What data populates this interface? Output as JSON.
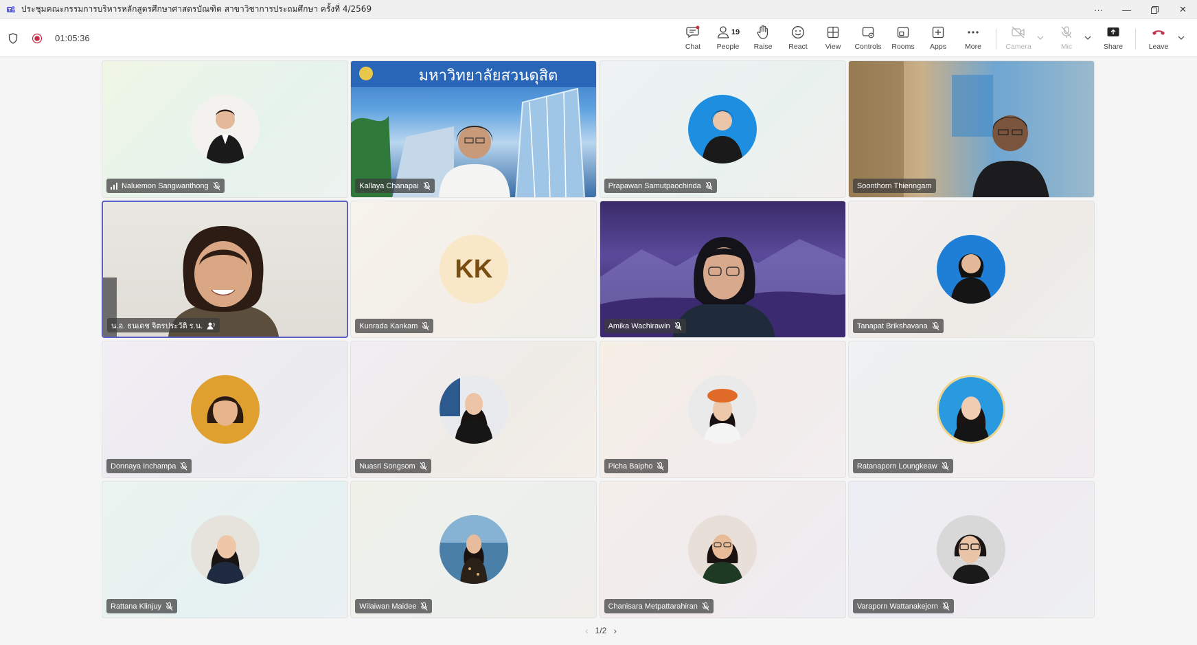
{
  "window": {
    "title": "ประชุมคณะกรรมการบริหารหลักสูตรศึกษาศาสตรบัณฑิต สาขาวิชาการประถมศึกษา ครั้งที่ 4/2569"
  },
  "meeting": {
    "elapsed": "01:05:36"
  },
  "toolbar": {
    "chat": "Chat",
    "people": "People",
    "people_count": "19",
    "raise": "Raise",
    "react": "React",
    "view": "View",
    "controls": "Controls",
    "rooms": "Rooms",
    "apps": "Apps",
    "more": "More",
    "camera": "Camera",
    "mic": "Mic",
    "share": "Share",
    "leave": "Leave"
  },
  "participants": [
    {
      "name": "Naluemon Sangwanthong",
      "muted": true,
      "signal": true
    },
    {
      "name": "Kallaya Chanapai",
      "muted": true,
      "video": true
    },
    {
      "name": "Prapawan Samutpaochinda",
      "muted": true
    },
    {
      "name": "Soonthorn Thienngam",
      "muted": false,
      "video": true
    },
    {
      "name": "น.อ. ธนเดช จิตรประวัติ ร.น.",
      "muted": false,
      "video": true,
      "speaking": true
    },
    {
      "name": "Kunrada Kankam",
      "muted": true,
      "initials": "KK"
    },
    {
      "name": "Amika Wachirawin",
      "muted": true,
      "video": true
    },
    {
      "name": "Tanapat Brikshavana",
      "muted": true
    },
    {
      "name": "Donnaya Inchampa",
      "muted": true
    },
    {
      "name": "Nuasri Songsom",
      "muted": true
    },
    {
      "name": "Picha Baipho",
      "muted": true
    },
    {
      "name": "Ratanaporn Loungkeaw",
      "muted": true
    },
    {
      "name": "Rattana Klinjuy",
      "muted": true
    },
    {
      "name": "Wilaiwan Maidee",
      "muted": true
    },
    {
      "name": "Chanisara Metpattarahiran",
      "muted": true
    },
    {
      "name": "Varaporn Wattanakejorn",
      "muted": true
    }
  ],
  "pager": {
    "label": "1/2"
  },
  "colors": {
    "accent": "#5b5fc7",
    "leave": "#c4314b",
    "record": "#c4314b"
  }
}
